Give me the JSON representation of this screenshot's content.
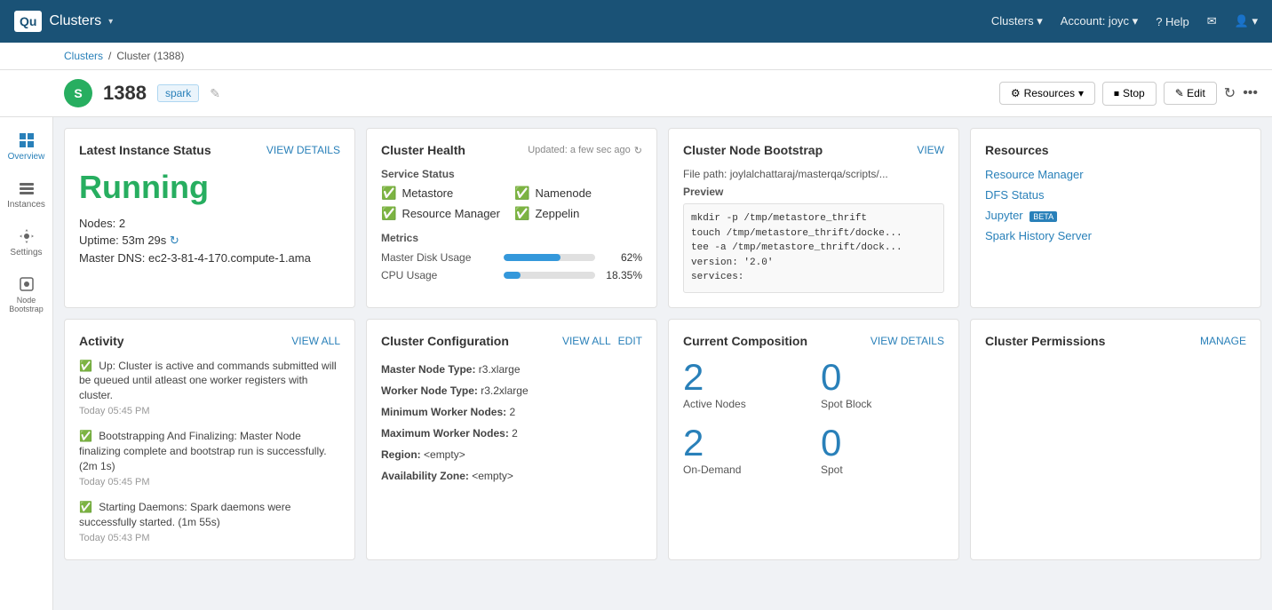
{
  "topnav": {
    "logo": "Qu",
    "title": "Clusters",
    "chevron": "▾",
    "nav_items": [
      "Clusters ▾",
      "Account: joyc ▾",
      "? Help",
      "✉",
      "👤 ▾"
    ]
  },
  "breadcrumb": {
    "parent": "Clusters",
    "separator": "/",
    "current": "Cluster (1388)"
  },
  "cluster": {
    "avatar_letter": "S",
    "name": "1388",
    "tag": "spark",
    "edit_icon": "✎"
  },
  "header_buttons": {
    "resources": "Resources",
    "stop": "Stop",
    "edit": "Edit"
  },
  "sidebar": {
    "items": [
      {
        "label": "Overview",
        "icon": "overview"
      },
      {
        "label": "Instances",
        "icon": "instances"
      },
      {
        "label": "Settings",
        "icon": "settings"
      },
      {
        "label": "Node Bootstrap",
        "icon": "node-bootstrap"
      }
    ]
  },
  "latest_instance": {
    "title": "Latest Instance Status",
    "view_details": "VIEW DETAILS",
    "status": "Running",
    "nodes_label": "Nodes:",
    "nodes_value": "2",
    "uptime_label": "Uptime:",
    "uptime_value": "53m 29s",
    "master_dns_label": "Master DNS:",
    "master_dns_value": "ec2-3-81-4-170.compute-1.ama"
  },
  "cluster_health": {
    "title": "Cluster Health",
    "updated": "Updated: a few sec ago",
    "service_status_label": "Service Status",
    "services": [
      {
        "name": "Metastore",
        "status": "ok"
      },
      {
        "name": "Namenode",
        "status": "ok"
      },
      {
        "name": "Resource Manager",
        "status": "ok"
      },
      {
        "name": "Zeppelin",
        "status": "ok"
      }
    ],
    "metrics_label": "Metrics",
    "metrics": [
      {
        "label": "Master Disk Usage",
        "value": "62%",
        "percent": 62
      },
      {
        "label": "CPU Usage",
        "value": "18.35%",
        "percent": 18
      }
    ]
  },
  "bootstrap": {
    "title": "Cluster Node Bootstrap",
    "view": "VIEW",
    "file_path": "File path: joylalchattaraj/masterqa/scripts/...",
    "preview_label": "Preview",
    "code_lines": [
      "mkdir -p /tmp/metastore_thrift",
      "touch /tmp/metastore_thrift/docke...",
      "tee -a /tmp/metastore_thrift/dock...",
      "version: '2.0'",
      "services:"
    ]
  },
  "resources": {
    "title": "Resources",
    "links": [
      {
        "label": "Resource Manager",
        "beta": false
      },
      {
        "label": "DFS Status",
        "beta": false
      },
      {
        "label": "Jupyter",
        "beta": true
      },
      {
        "label": "Spark History Server",
        "beta": false
      }
    ]
  },
  "activity": {
    "title": "Activity",
    "view_all": "VIEW ALL",
    "items": [
      {
        "icon": "✅",
        "text": "Up: Cluster is active and commands submitted will be queued until atleast one worker registers with cluster.",
        "time": "Today 05:45 PM"
      },
      {
        "icon": "✅",
        "text": "Bootstrapping And Finalizing: Master Node finalizing complete and bootstrap run is successfully. (2m 1s)",
        "time": "Today 05:45 PM"
      },
      {
        "icon": "✅",
        "text": "Starting Daemons: Spark daemons were successfully started. (1m 55s)",
        "time": "Today 05:43 PM"
      }
    ]
  },
  "cluster_config": {
    "title": "Cluster Configuration",
    "view_all": "VIEW ALL",
    "edit": "EDIT",
    "fields": [
      {
        "key": "Master Node Type:",
        "value": "r3.xlarge"
      },
      {
        "key": "Worker Node Type:",
        "value": "r3.2xlarge"
      },
      {
        "key": "Minimum Worker Nodes:",
        "value": "2"
      },
      {
        "key": "Maximum Worker Nodes:",
        "value": "2"
      },
      {
        "key": "Region:",
        "value": "<empty>"
      },
      {
        "key": "Availability Zone:",
        "value": "<empty>"
      }
    ]
  },
  "composition": {
    "title": "Current Composition",
    "view_details": "VIEW DETAILS",
    "stats": [
      {
        "number": "2",
        "label": "Active Nodes"
      },
      {
        "number": "0",
        "label": "Spot Block"
      },
      {
        "number": "2",
        "label": "On-Demand"
      },
      {
        "number": "0",
        "label": "Spot"
      }
    ]
  },
  "permissions": {
    "title": "Cluster Permissions",
    "manage": "MANAGE"
  }
}
